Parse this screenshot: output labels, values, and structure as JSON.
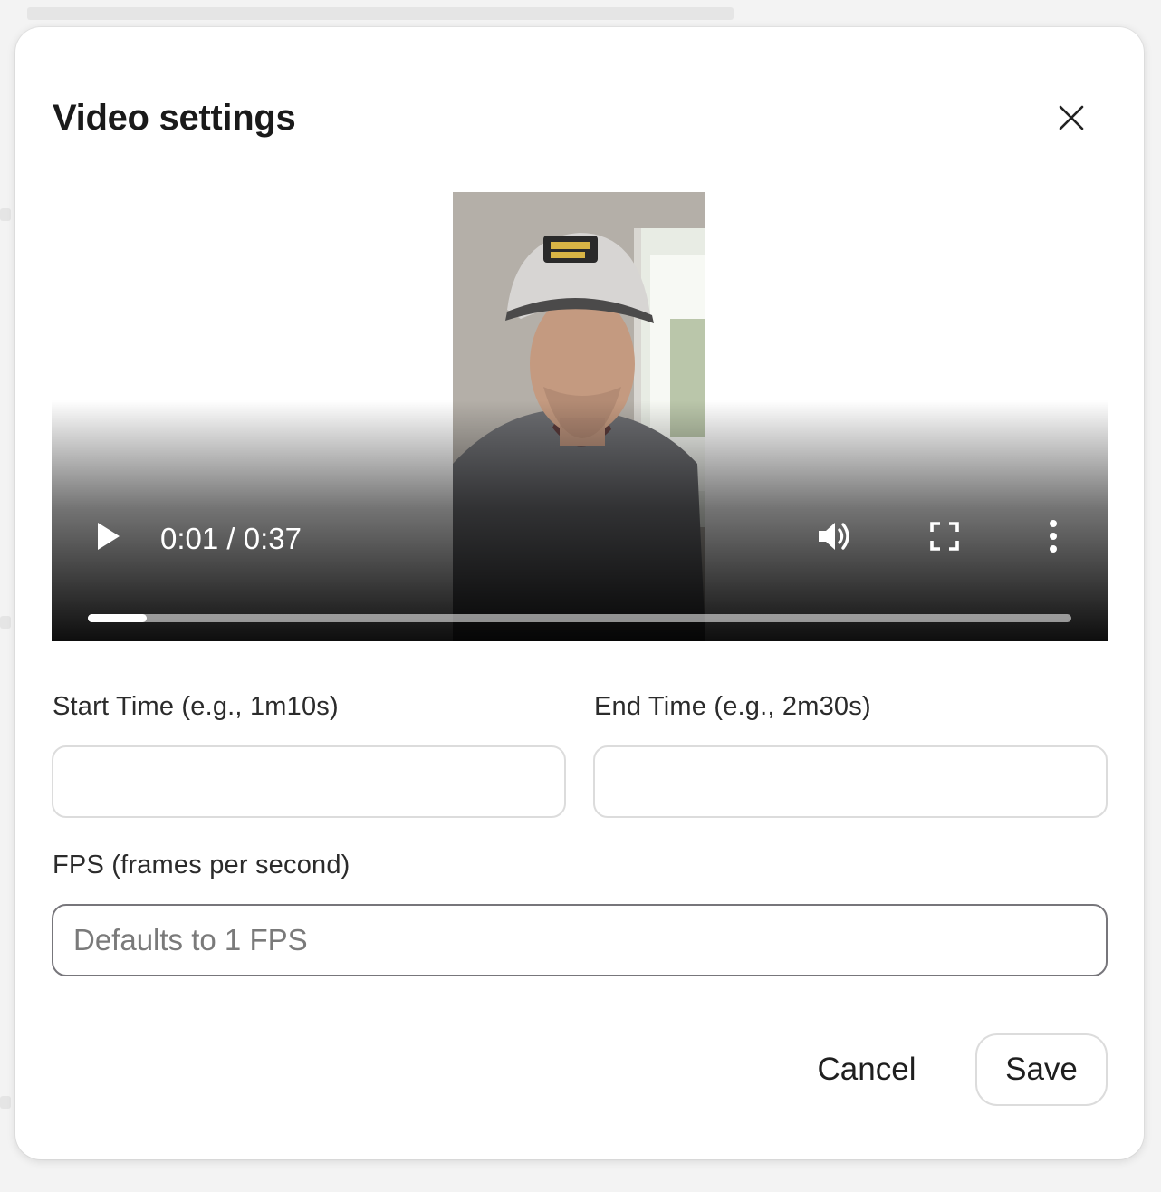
{
  "dialog": {
    "title": "Video settings",
    "close_icon": "close-icon"
  },
  "video": {
    "time_display": "0:01 / 0:37",
    "progress": 0.06,
    "icons": {
      "play": "play-icon",
      "volume": "volume-icon",
      "fullscreen": "fullscreen-icon",
      "more": "more-vertical-icon"
    }
  },
  "form": {
    "start_time": {
      "label": "Start Time (e.g., 1m10s)",
      "value": "",
      "placeholder": ""
    },
    "end_time": {
      "label": "End Time (e.g., 2m30s)",
      "value": "",
      "placeholder": ""
    },
    "fps": {
      "label": "FPS (frames per second)",
      "value": "",
      "placeholder": "Defaults to 1 FPS"
    }
  },
  "actions": {
    "cancel_label": "Cancel",
    "save_label": "Save"
  }
}
